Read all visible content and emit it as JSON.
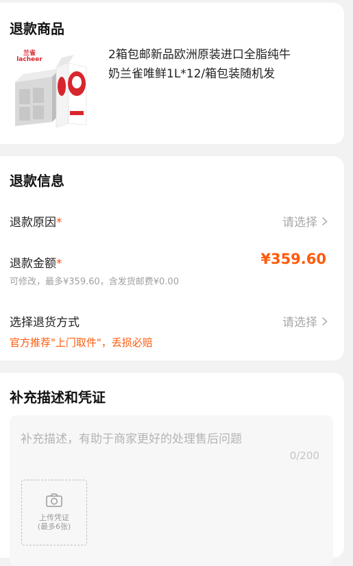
{
  "product_section": {
    "title": "退款商品",
    "product_title": "2箱包邮新品欧洲原装进口全脂纯牛奶兰雀唯鲜1L*12/箱包装随机发",
    "product_title_line1": "2箱包邮新品欧洲原装进口全脂纯牛",
    "product_title_line2": "奶兰雀唯鲜1L*12/箱包装随机发",
    "brand_logo_cn": "兰雀",
    "brand_logo_en": "lacheer"
  },
  "refund_info": {
    "title": "退款信息",
    "reason_label": "退款原因",
    "required_mark": "*",
    "reason_placeholder": "请选择",
    "amount_label": "退款金额",
    "amount_value": "¥359.60",
    "amount_note": "可修改，最多¥359.60，含发货邮费¥0.00",
    "return_method_label": "选择退货方式",
    "return_method_placeholder": "请选择",
    "return_method_promo": "官方推荐\"上门取件\"，丢损必赔"
  },
  "evidence": {
    "title": "补充描述和凭证",
    "description_placeholder": "补充描述，有助于商家更好的处理售后问题",
    "char_count": "0/200",
    "upload_label_line1": "上传凭证",
    "upload_label_line2": "(最多6张)"
  },
  "colors": {
    "accent": "#ff5a0a",
    "required": "#ff4f14",
    "placeholder": "#a8a8a8",
    "background": "#f2f2f2"
  },
  "icons": {
    "chevron": "chevron-right-icon",
    "camera": "camera-icon"
  }
}
